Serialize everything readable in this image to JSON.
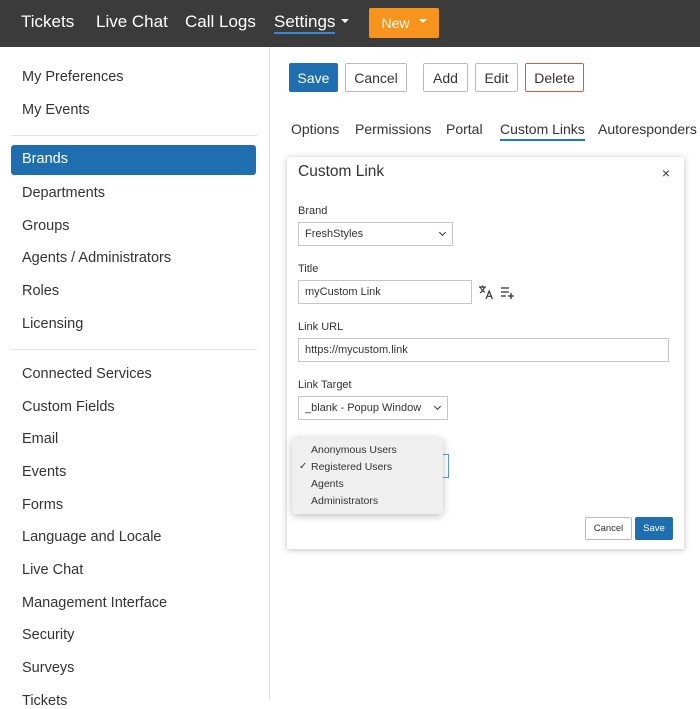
{
  "topnav": {
    "items": [
      "Tickets",
      "Live Chat",
      "Call Logs",
      "Settings"
    ],
    "new_label": "New"
  },
  "sidebar": {
    "group1": [
      "My Preferences",
      "My Events"
    ],
    "group2": [
      "Brands",
      "Departments",
      "Groups",
      "Agents / Administrators",
      "Roles",
      "Licensing"
    ],
    "group3": [
      "Connected Services",
      "Custom Fields",
      "Email",
      "Events",
      "Forms",
      "Language and Locale",
      "Live Chat",
      "Management Interface",
      "Security",
      "Surveys",
      "Tickets"
    ],
    "active": "Brands"
  },
  "toolbar": {
    "save": "Save",
    "cancel": "Cancel",
    "add": "Add",
    "edit": "Edit",
    "delete": "Delete"
  },
  "tabs": [
    "Options",
    "Permissions",
    "Portal",
    "Custom Links",
    "Autoresponders"
  ],
  "active_tab": "Custom Links",
  "modal": {
    "title": "Custom Link",
    "close": "×",
    "brand_label": "Brand",
    "brand_value": "FreshStyles",
    "title_label": "Title",
    "title_value": "myCustom Link",
    "url_label": "Link URL",
    "url_value": "https://mycustom.link",
    "target_label": "Link Target",
    "target_value": "_blank - Popup Window",
    "visibility_options": [
      "Anonymous Users",
      "Registered Users",
      "Agents",
      "Administrators"
    ],
    "visibility_selected": "Registered Users",
    "cancel": "Cancel",
    "save": "Save"
  },
  "colors": {
    "topbar": "#3b3b3b",
    "accent": "#1f6fb0",
    "new_button": "#f7941d",
    "delete_border": "#e05a3a"
  }
}
